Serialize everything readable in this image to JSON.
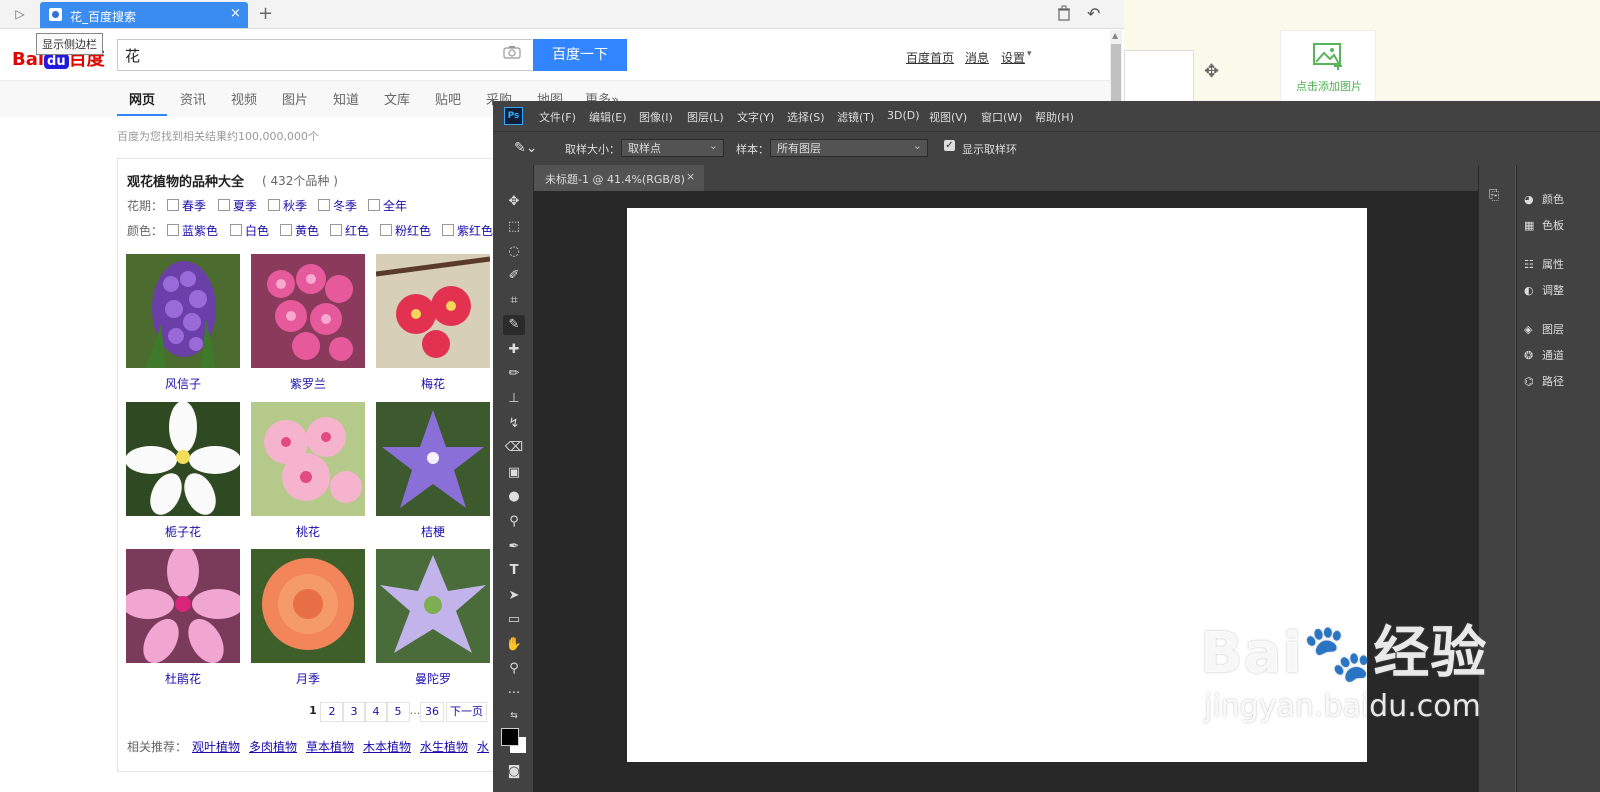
{
  "browser": {
    "tab_title": "花_百度搜索",
    "tab_close": "×",
    "new_tab": "+",
    "sidebar_toggle": "▷",
    "tooltip": "显示侧边栏",
    "undo": "↶"
  },
  "search": {
    "logo_b": "Bai",
    "logo_du": "du",
    "logo_cn": "百度",
    "query": "花",
    "button": "百度一下",
    "links": [
      "百度首页",
      "消息",
      "设置"
    ]
  },
  "nav": {
    "items": [
      "网页",
      "资讯",
      "视频",
      "图片",
      "知道",
      "文库",
      "贴吧",
      "采购",
      "地图",
      "更多»"
    ]
  },
  "results": {
    "count_text": "百度为您找到相关结果约100,000,000个"
  },
  "card": {
    "title": "观花植物的品种大全",
    "count": "( 432个品种 )",
    "season_label": "花期：",
    "seasons": [
      "春季",
      "夏季",
      "秋季",
      "冬季",
      "全年"
    ],
    "color_label": "颜色：",
    "colors": [
      "蓝紫色",
      "白色",
      "黄色",
      "红色",
      "粉红色",
      "紫红色"
    ],
    "plants": [
      "风信子",
      "紫罗兰",
      "梅花",
      "栀子花",
      "桃花",
      "桔梗",
      "杜鹃花",
      "月季",
      "曼陀罗"
    ],
    "pages": [
      "1",
      "2",
      "3",
      "4",
      "5",
      "...",
      "36",
      "下一页"
    ],
    "related_label": "相关推荐：",
    "related": [
      "观叶植物",
      "多肉植物",
      "草本植物",
      "木本植物",
      "水生植物",
      "水"
    ]
  },
  "right_app": {
    "add_picture": "点击添加图片"
  },
  "ps": {
    "logo": "Ps",
    "menus": [
      "文件(F)",
      "编辑(E)",
      "图像(I)",
      "图层(L)",
      "文字(Y)",
      "选择(S)",
      "滤镜(T)",
      "3D(D)",
      "视图(V)",
      "窗口(W)",
      "帮助(H)"
    ],
    "sample_size_label": "取样大小：",
    "sample_size_value": "取样点",
    "sample_label": "样本：",
    "sample_value": "所有图层",
    "show_ring_label": "显示取样环",
    "doc_tab": "未标题-1 @ 41.4%(RGB/8)",
    "doc_close": "×",
    "panels": [
      {
        "icon": "palette-icon",
        "label": "颜色"
      },
      {
        "icon": "swatches-icon",
        "label": "色板"
      },
      {
        "icon": "properties-icon",
        "label": "属性"
      },
      {
        "icon": "adjustments-icon",
        "label": "调整"
      },
      {
        "icon": "layers-icon",
        "label": "图层"
      },
      {
        "icon": "channels-icon",
        "label": "通道"
      },
      {
        "icon": "paths-icon",
        "label": "路径"
      }
    ]
  },
  "watermark": {
    "brand": "Bai",
    "brand2": "经验",
    "url": "jingyan.baidu.com"
  },
  "colors": {
    "tab_blue": "#3b8cf0",
    "search_blue": "#3385ff",
    "link_blue": "#1a0dab",
    "ps_dark": "#424242",
    "ps_canvas_bg": "#282828"
  }
}
